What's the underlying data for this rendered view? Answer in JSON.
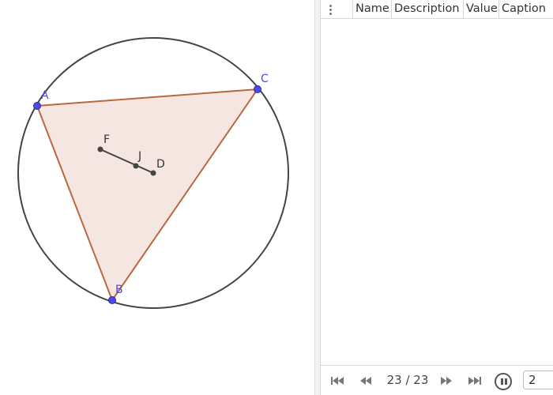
{
  "graphics": {
    "circle": {
      "name": "circle"
    },
    "triangle": {
      "vertices": [
        "A",
        "B",
        "C"
      ],
      "fill": "#f5e6e1",
      "stroke": "#b9683f"
    },
    "points": [
      {
        "id": "A",
        "label": "A",
        "color": "#4a4ae6"
      },
      {
        "id": "B",
        "label": "B",
        "color": "#4a4ae6"
      },
      {
        "id": "C",
        "label": "C",
        "color": "#4a4ae6"
      },
      {
        "id": "F",
        "label": "F",
        "color": "#333333"
      },
      {
        "id": "J",
        "label": "J",
        "color": "#333333"
      },
      {
        "id": "D",
        "label": "D",
        "color": "#333333"
      }
    ],
    "segment": {
      "from": "F",
      "to": "D"
    }
  },
  "protocol": {
    "columns": [
      "Name",
      "Description",
      "Value",
      "Caption"
    ],
    "rows": []
  },
  "navigation": {
    "step_text": "23 / 23",
    "speed_value": "2",
    "buttons": [
      "first-step-icon",
      "previous-step-icon",
      "next-step-icon",
      "last-step-icon",
      "pause-icon"
    ]
  },
  "colors": {
    "point_free": "#4a4ae6",
    "point_dependent": "#333333",
    "polygon_stroke": "#b9683f",
    "polygon_fill": "#f5e6e1",
    "circle_stroke": "#444444"
  }
}
